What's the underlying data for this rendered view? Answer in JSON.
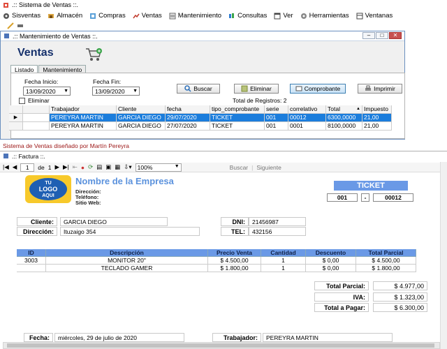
{
  "main_window": {
    "title": ".:: Sistema de Ventas ::.",
    "menu": [
      {
        "label": "Sisventas",
        "icon": "gear-icon"
      },
      {
        "label": "Almacén",
        "icon": "warehouse-icon"
      },
      {
        "label": "Compras",
        "icon": "compras-icon"
      },
      {
        "label": "Ventas",
        "icon": "ventas-icon"
      },
      {
        "label": "Mantenimiento",
        "icon": "wrench-icon"
      },
      {
        "label": "Consultas",
        "icon": "query-icon"
      },
      {
        "label": "Ver",
        "icon": "view-icon"
      },
      {
        "label": "Herramientas",
        "icon": "tools-icon"
      },
      {
        "label": "Ventanas",
        "icon": "window-icon"
      }
    ]
  },
  "ventas_window": {
    "title": ".:: Mantenimiento de Ventas ::.",
    "heading": "Ventas",
    "tabs": [
      "Listado",
      "Mantenimiento"
    ],
    "fecha_inicio_label": "Fecha Inicio:",
    "fecha_inicio_value": "13/09/2020",
    "fecha_fin_label": "Fecha Fin:",
    "fecha_fin_value": "13/09/2020",
    "eliminar_check_label": "Eliminar",
    "buttons": {
      "buscar": "Buscar",
      "eliminar": "Eliminar",
      "comprobante": "Comprobante",
      "imprimir": "Imprimir"
    },
    "total_registros": "Total de Registros: 2",
    "grid": {
      "columns": [
        "Trabajador",
        "Cliente",
        "fecha",
        "tipo_comprobante",
        "serie",
        "correlativo",
        "Total",
        "Impuesto"
      ],
      "sort_indicator": "▲",
      "rows": [
        [
          "PEREYRA MARTIN",
          "GARCIA DIEGO",
          "29/07/2020",
          "TICKET",
          "001",
          "00012",
          "6300,0000",
          "21,00"
        ],
        [
          "PEREYRA MARTIN",
          "GARCIA DIEGO",
          "27/07/2020",
          "TICKET",
          "001",
          "0001",
          "8100,0000",
          "21,00"
        ]
      ]
    }
  },
  "status_text": "Sistema de Ventas diseñado por Martín Pereyra",
  "factura_window": {
    "title": ".:: Factura ::.",
    "toolbar": {
      "page_current": "1",
      "page_of": "de",
      "page_total": "1",
      "zoom": "100%",
      "buscar": "Buscar",
      "siguiente": "Siguiente"
    },
    "logo_text": [
      "TU",
      "LOGO",
      "AQUI"
    ],
    "company_name": "Nombre de la Empresa",
    "company_meta": [
      "Dirección:",
      "Teléfono:",
      "Sitio Web:"
    ],
    "ticket_label": "TICKET",
    "serie": "001",
    "separator": "-",
    "correlativo": "00012",
    "cliente_label": "Cliente:",
    "cliente_value": "GARCIA DIEGO",
    "dni_label": "DNI:",
    "dni_value": "21456987",
    "direccion_label": "Dirección:",
    "direccion_value": "Ituzaigo 354",
    "tel_label": "TEL:",
    "tel_value": "432156",
    "items": {
      "columns": [
        "ID",
        "Descripción",
        "Precio Venta",
        "Cantidad",
        "Descuento",
        "Total Parcial"
      ],
      "rows": [
        [
          "3003",
          "MONITOR 20\"",
          "$ 4.500,00",
          "1",
          "$ 0,00",
          "$ 4.500,00"
        ],
        [
          "",
          "TECLADO GAMER",
          "$ 1.800,00",
          "1",
          "$ 0,00",
          "$ 1.800,00"
        ]
      ]
    },
    "totals": [
      {
        "label": "Total Parcial:",
        "value": "$ 4.977,00"
      },
      {
        "label": "IVA:",
        "value": "$ 1.323,00"
      },
      {
        "label": "Total a Pagar:",
        "value": "$ 6.300,00"
      }
    ],
    "fecha_label": "Fecha:",
    "fecha_value": "miércoles, 29 de julio de 2020",
    "trabajador_label": "Trabajador:",
    "trabajador_value": "PEREYRA MARTIN"
  }
}
